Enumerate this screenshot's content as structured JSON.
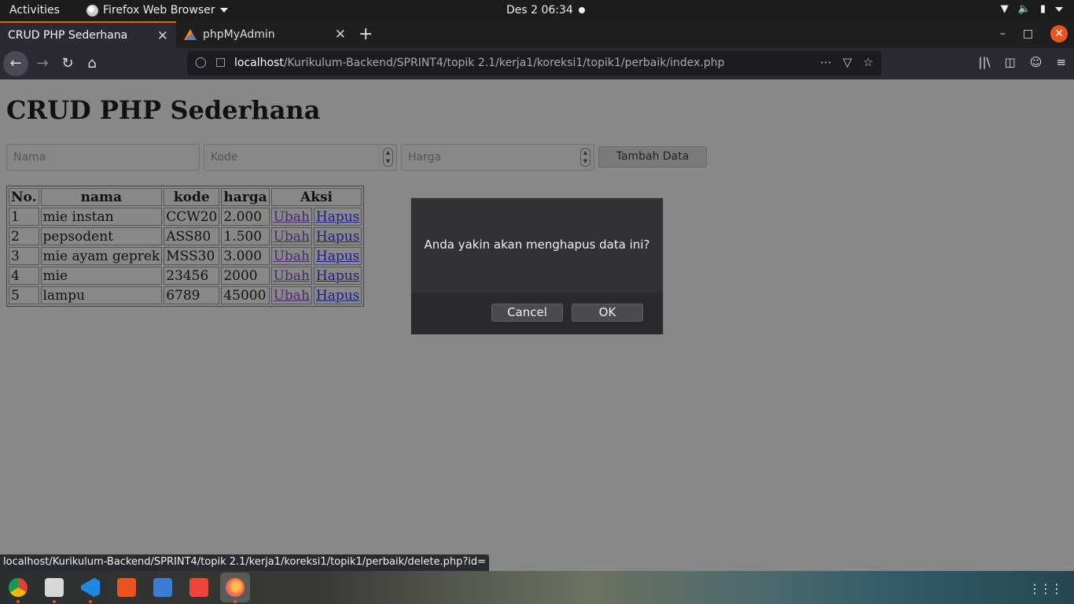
{
  "system_bar": {
    "activities": "Activities",
    "app_name": "Firefox Web Browser",
    "clock": "Des 2  06:34"
  },
  "tabs": [
    {
      "title": "CRUD PHP Sederhana",
      "active": true
    },
    {
      "title": "phpMyAdmin",
      "active": false
    }
  ],
  "address_bar": {
    "host": "localhost",
    "path": "/Kurikulum-Backend/SPRINT4/topik 2.1/kerja1/koreksi1/topik1/perbaik/index.php"
  },
  "page": {
    "title": "CRUD PHP Sederhana",
    "form": {
      "nama_placeholder": "Nama",
      "kode_placeholder": "Kode",
      "harga_placeholder": "Harga",
      "submit_label": "Tambah Data"
    },
    "table": {
      "headers": [
        "No.",
        "nama",
        "kode",
        "harga",
        "Aksi"
      ],
      "rows": [
        {
          "no": "1",
          "nama": "mie instan",
          "kode": "CCW20",
          "harga": "2.000",
          "edit": "Ubah",
          "delete": "Hapus"
        },
        {
          "no": "2",
          "nama": "pepsodent",
          "kode": "ASS80",
          "harga": "1.500",
          "edit": "Ubah",
          "delete": "Hapus"
        },
        {
          "no": "3",
          "nama": "mie ayam geprek",
          "kode": "MSS30",
          "harga": "3.000",
          "edit": "Ubah",
          "delete": "Hapus"
        },
        {
          "no": "4",
          "nama": "mie",
          "kode": "23456",
          "harga": "2000",
          "edit": "Ubah",
          "delete": "Hapus"
        },
        {
          "no": "5",
          "nama": "lampu",
          "kode": "6789",
          "harga": "45000",
          "edit": "Ubah",
          "delete": "Hapus"
        }
      ]
    }
  },
  "dialog": {
    "message": "Anda yakin akan menghapus data ini?",
    "cancel_label": "Cancel",
    "ok_label": "OK"
  },
  "status_url": "localhost/Kurikulum-Backend/SPRINT4/topik 2.1/kerja1/koreksi1/topik1/perbaik/delete.php?id=",
  "dock": {
    "apps": [
      "chrome-icon",
      "files-icon",
      "vscode-icon",
      "software-center-icon",
      "bluetooth-icon",
      "anydesk-icon",
      "firefox-icon"
    ]
  },
  "colors": {
    "accent": "#e95420",
    "dialog_bg": "#2a2a2e",
    "link": "#1d1d8c"
  }
}
